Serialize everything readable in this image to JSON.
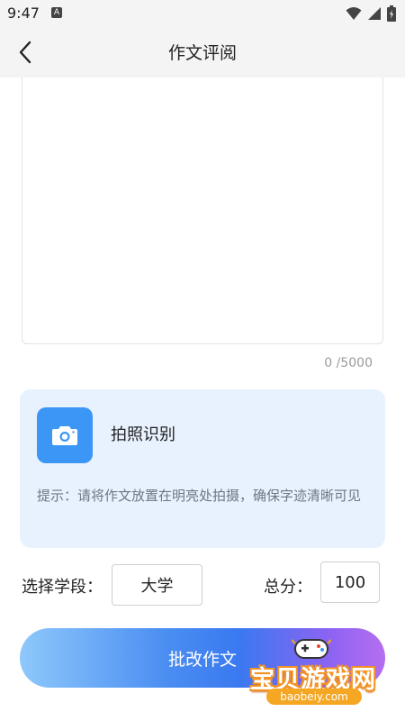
{
  "status_bar": {
    "time": "9:47",
    "notification_icon": "A",
    "icons": [
      "wifi-icon",
      "signal-icon",
      "battery-icon"
    ]
  },
  "app_bar": {
    "title": "作文评阅",
    "back_icon": "chevron-left-icon"
  },
  "editor": {
    "value": "",
    "char_count": "0 /5000"
  },
  "ocr": {
    "label": "拍照识别",
    "icon": "camera-icon",
    "tip": "提示：请将作文放置在明亮处拍摄，确保字迹清晰可见",
    "card_color": "#e8f2fe",
    "button_color": "#3b96f5"
  },
  "grade": {
    "label": "选择学段：",
    "selected": "大学"
  },
  "score": {
    "label": "总分：",
    "value": "100"
  },
  "submit": {
    "label": "批改作文"
  },
  "watermark": {
    "title": "宝贝游戏网",
    "url": "baobeiy.com"
  }
}
